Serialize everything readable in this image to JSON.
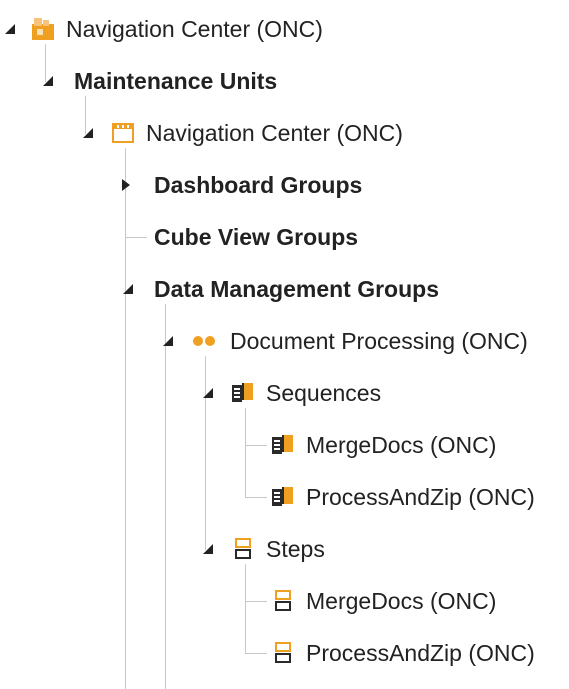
{
  "tree": {
    "root": {
      "label": "Navigation Center (ONC)",
      "icon": "workspace-icon",
      "children": {
        "maintenance_units": {
          "label": "Maintenance Units",
          "children": {
            "unit": {
              "label": "Navigation Center (ONC)",
              "icon": "maintenance-unit-icon",
              "children": {
                "dashboard_groups": {
                  "label": "Dashboard Groups",
                  "state": "collapsed"
                },
                "cube_view_groups": {
                  "label": "Cube View Groups"
                },
                "data_management_groups": {
                  "label": "Data Management Groups",
                  "children": {
                    "document_processing": {
                      "label": "Document Processing (ONC)",
                      "icon": "data-management-group-icon",
                      "children": {
                        "sequences": {
                          "label": "Sequences",
                          "icon": "sequence-icon",
                          "items": [
                            "MergeDocs (ONC)",
                            "ProcessAndZip (ONC)"
                          ]
                        },
                        "steps": {
                          "label": "Steps",
                          "icon": "step-icon",
                          "items": [
                            "MergeDocs (ONC)",
                            "ProcessAndZip (ONC)"
                          ]
                        }
                      }
                    }
                  }
                }
              }
            }
          }
        }
      }
    }
  },
  "colors": {
    "accent": "#f0a020",
    "connector": "#c8c8c8",
    "text": "#222222",
    "icon_dark": "#2a2a2a"
  }
}
